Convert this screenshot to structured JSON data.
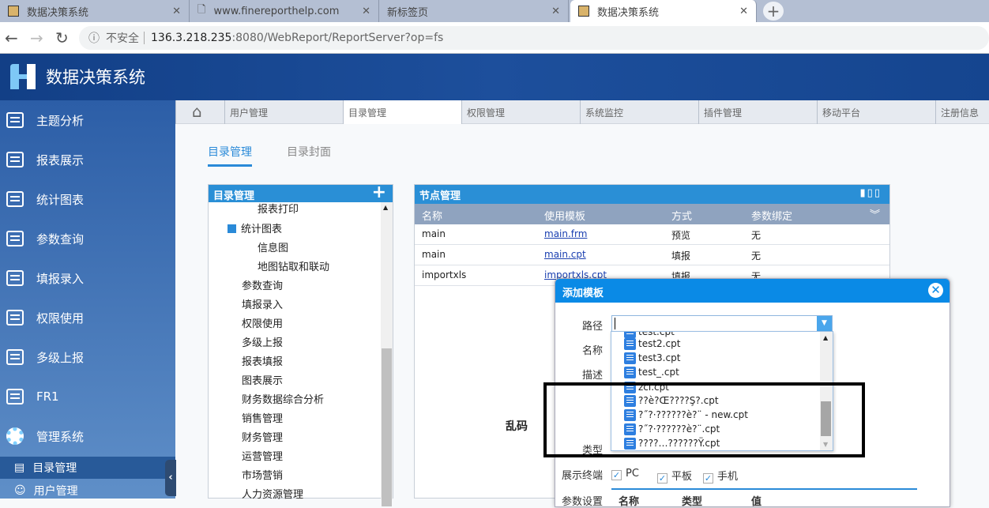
{
  "browser": {
    "tabs": [
      {
        "title": "数据决策系统",
        "active": false
      },
      {
        "title": "www.finereporthelp.com",
        "active": false
      },
      {
        "title": "新标签页",
        "active": false
      },
      {
        "title": "数据决策系统",
        "active": true
      }
    ],
    "security": "不安全",
    "url_host": "136.3.218.235",
    "url_rest": ":8080/WebReport/ReportServer?op=fs"
  },
  "app": {
    "title": "数据决策系统"
  },
  "sidebar": {
    "items": [
      "主题分析",
      "报表展示",
      "统计图表",
      "参数查询",
      "填报录入",
      "权限使用",
      "多级上报",
      "FR1",
      "管理系统"
    ],
    "subitems": [
      "目录管理",
      "用户管理"
    ]
  },
  "main_tabs": [
    "用户管理",
    "目录管理",
    "权限管理",
    "系统监控",
    "插件管理",
    "移动平台",
    "注册信息"
  ],
  "sub_tabs": [
    "目录管理",
    "目录封面"
  ],
  "tree": {
    "title": "目录管理",
    "nodes": [
      "报表打印",
      "统计图表",
      "信息图",
      "地图钻取和联动",
      "参数查询",
      "填报录入",
      "权限使用",
      "多级上报",
      "报表填报",
      "图表展示",
      "财务数据综合分析",
      "销售管理",
      "财务管理",
      "运营管理",
      "市场营销",
      "人力资源管理"
    ]
  },
  "nodes_panel": {
    "title": "节点管理",
    "columns": [
      "名称",
      "使用模板",
      "方式",
      "参数绑定"
    ],
    "rows": [
      [
        "main",
        "main.frm",
        "预览",
        "无"
      ],
      [
        "main",
        "main.cpt",
        "填报",
        "无"
      ],
      [
        "importxls",
        "importxls.cpt",
        "填报",
        "无"
      ]
    ]
  },
  "dialog": {
    "title": "添加模板",
    "labels": {
      "path": "路径",
      "name": "名称",
      "desc": "描述",
      "type": "类型",
      "terminal": "展示终端",
      "params": "参数设置"
    },
    "dropdown_items": [
      "test.cpt",
      "test2.cpt",
      "test3.cpt",
      "test_.cpt",
      "zcl.cpt",
      "??è?Œ????Ş?.cpt",
      "?˝?·??????è?¨ - new.cpt",
      "?˝?·??????è?¨.cpt",
      "????…??????Ÿ.cpt"
    ],
    "terminals": [
      {
        "label": "PC",
        "checked": true
      },
      {
        "label": "平板",
        "checked": true
      },
      {
        "label": "手机",
        "checked": true
      }
    ],
    "param_columns": [
      "名称",
      "类型",
      "值"
    ]
  },
  "annotation": "乱码"
}
